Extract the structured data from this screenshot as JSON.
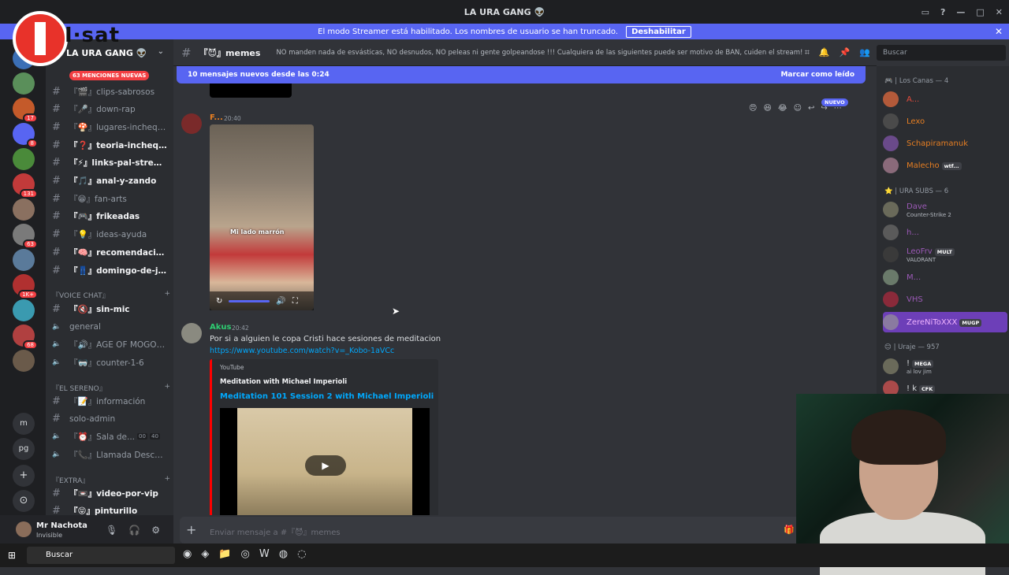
{
  "window": {
    "title": "LA URA GANG 👽",
    "controls": [
      "—",
      "□",
      "✕"
    ]
  },
  "banner": {
    "text": "El modo Streamer está habilitado. Los nombres de usuario se han truncado.",
    "button": "Deshabilitar"
  },
  "logo": {
    "text": "I·sat"
  },
  "guilds": [
    {
      "color": "#3b6fb6",
      "badge": ""
    },
    {
      "color": "#5a8f5a",
      "badge": ""
    },
    {
      "color": "#c45a2a",
      "badge": "17"
    },
    {
      "color": "#5865f2",
      "badge": "8"
    },
    {
      "color": "#4a8a3a",
      "badge": ""
    },
    {
      "color": "#c23a3a",
      "badge": "131"
    },
    {
      "color": "#8a7060",
      "badge": ""
    },
    {
      "color": "#7a7a7a",
      "badge": "63"
    },
    {
      "color": "#5a7a9a",
      "badge": ""
    },
    {
      "color": "#b03030",
      "badge": "1K+"
    },
    {
      "color": "#3a9ab0",
      "badge": ""
    },
    {
      "color": "#b04040",
      "badge": "68"
    },
    {
      "color": "#6a5a4a",
      "badge": ""
    }
  ],
  "guild_letters": [
    "m",
    "pg"
  ],
  "server": {
    "name": "LA URA GANG 👽",
    "mention_pill": "63 MENCIONES NUEVAS",
    "channels": [
      {
        "label": "『🎬』clips-sabrosos",
        "unread": false
      },
      {
        "label": "『🎤』down-rap",
        "unread": false
      },
      {
        "label": "『🍄』lugares-inchequeables",
        "unread": false
      },
      {
        "label": "『❓』teoria-inchequeables",
        "unread": true
      },
      {
        "label": "『⚡』links-pal-stream",
        "unread": true
      },
      {
        "label": "『🎵』anal-y-zando",
        "unread": true
      },
      {
        "label": "『😁』fan-arts",
        "unread": false
      },
      {
        "label": "『🎮』frikeadas",
        "unread": true
      },
      {
        "label": "『💡』ideas-ayuda",
        "unread": false
      },
      {
        "label": "『🧠』recomendaciones",
        "unread": true
      },
      {
        "label": "『👖』domingo-de-joggin",
        "unread": true
      }
    ],
    "cat_voice": "『VOICE CHAT』",
    "voice": [
      {
        "label": "『🔇』sin-mic",
        "unread": true
      },
      {
        "label": "general",
        "unread": false
      },
      {
        "label": "『🔊』AGE OF MOGOLLAS",
        "unread": false
      },
      {
        "label": "『🥽』counter-1-6",
        "unread": false
      }
    ],
    "cat_sereno": "『EL SERENO』",
    "sereno": [
      {
        "label": "『📝』información",
        "unread": false
      },
      {
        "label": "solo-admin",
        "unread": false
      },
      {
        "label": "『⏰』Sala de...",
        "unread": false
      },
      {
        "label": "『📞』Llamada Desconocida",
        "unread": false
      }
    ],
    "sala_counts": [
      "00",
      "40"
    ],
    "cat_extra": "『EXTRA』",
    "extra": [
      {
        "label": "『📼』video-por-vip",
        "unread": true
      },
      {
        "label": "『😝』pinturillo",
        "unread": true
      }
    ]
  },
  "user": {
    "name": "Mr Nachota",
    "status": "Invisible"
  },
  "channel_header": {
    "name": "『😈』memes",
    "topic": "NO manden nada de esvásticas, NO desnudos, NO peleas ni gente golpeandose !!! Cualquiera de las siguientes puede ser motivo de BAN, cuiden el stream!"
  },
  "search_placeholder": "Buscar",
  "new_messages": {
    "text": "10 mensajes nuevos desde las 0:24",
    "action": "Marcar como leído"
  },
  "messages": [
    {
      "author": "F...",
      "author_color": "#e67e22",
      "time": "20:40",
      "video_caption": "Mi lado marrón",
      "new_label": "NUEVO"
    },
    {
      "author": "Akus",
      "author_color": "#2ecc71",
      "time": "20:42",
      "text": "Por si a alguien le copa Cristi hace sesiones de meditacion",
      "link": "https://www.youtube.com/watch?v=_Kobo-1aVCc",
      "embed": {
        "provider": "YouTube",
        "author": "Meditation with Michael Imperioli",
        "title": "Meditation 101 Session 2 with Michael Imperioli"
      }
    }
  ],
  "composer": {
    "placeholder": "Enviar mensaje a #『😈』memes"
  },
  "members": {
    "cat1": "🎮 | Los Canas — 4",
    "group1": [
      {
        "name": "A...",
        "color": "#e74c3c",
        "av": "#b35a3a",
        "tag": "",
        "activity": ""
      },
      {
        "name": "Lexo",
        "color": "#e67e22",
        "av": "#4a4a4a",
        "tag": "",
        "activity": ""
      },
      {
        "name": "Schapiramanuk",
        "color": "#e67e22",
        "av": "#6a4a8a",
        "tag": "",
        "activity": ""
      },
      {
        "name": "Malecho",
        "color": "#e67e22",
        "av": "#8a6a7a",
        "tag": "wtf...",
        "activity": ""
      }
    ],
    "cat2": "⭐ | URA SUBS — 6",
    "group2": [
      {
        "name": "Dave",
        "color": "#9b59b6",
        "av": "#6a6a5a",
        "tag": "",
        "activity": "Counter-Strike 2"
      },
      {
        "name": "h...",
        "color": "#9b59b6",
        "av": "#5a5a5a",
        "tag": "",
        "activity": ""
      },
      {
        "name": "LeoFrv",
        "color": "#9b59b6",
        "av": "#3a3a3a",
        "tag": "MULT",
        "activity": "VALORANT"
      },
      {
        "name": "M...",
        "color": "#9b59b6",
        "av": "#6a7a6a",
        "tag": "",
        "activity": ""
      },
      {
        "name": "VHS",
        "color": "#9b59b6",
        "av": "#8a2a3a",
        "tag": "",
        "activity": ""
      },
      {
        "name": "ZereNiToXXX",
        "color": "#f0b3ff",
        "av": "#8a7aa0",
        "tag": "MUGP",
        "activity": ""
      }
    ],
    "cat3": "😊 | Uraje — 957",
    "group3": [
      {
        "name": "!",
        "color": "#dbdee1",
        "av": "#6a6a5a",
        "tag": "MEGA",
        "activity": "ai lov jim"
      },
      {
        "name": "! k",
        "color": "#dbdee1",
        "av": "#aa4a4a",
        "tag": "CFK",
        "activity": ""
      }
    ]
  },
  "taskbar": {
    "search": "Buscar"
  }
}
